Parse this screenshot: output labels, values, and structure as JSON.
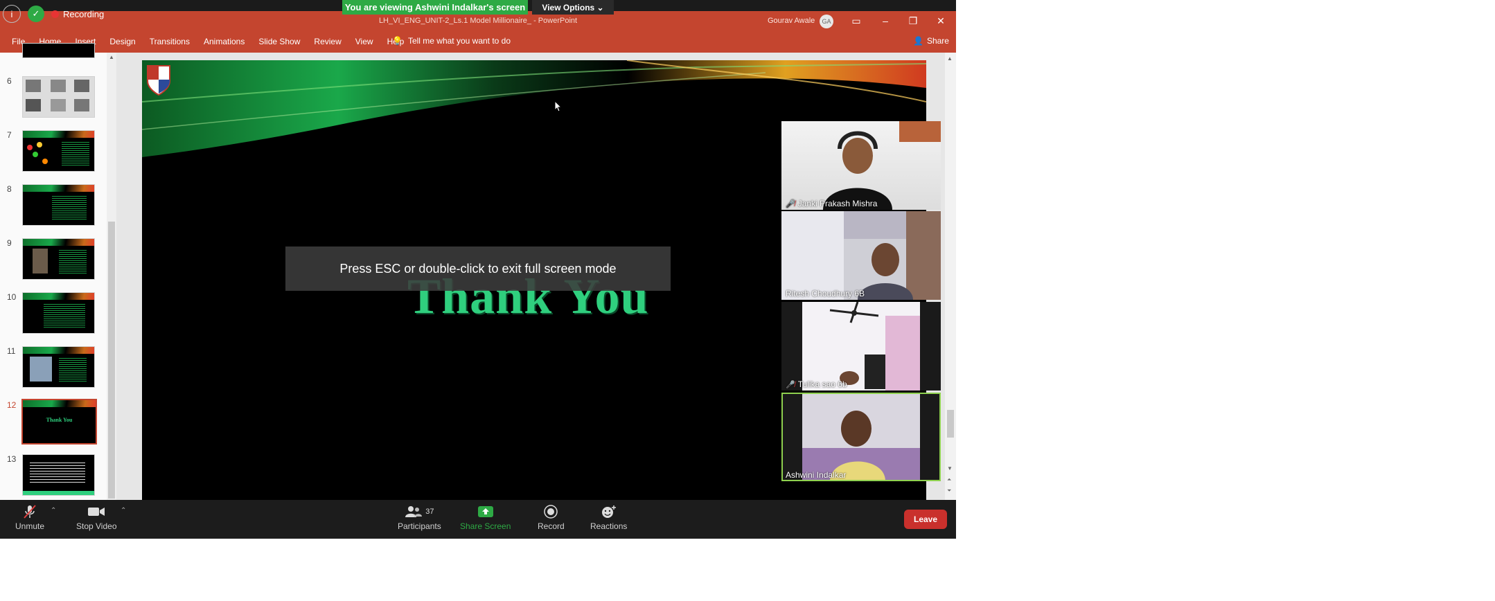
{
  "zoom": {
    "banner": "You are viewing Ashwini Indalkar's screen",
    "view_options": "View Options",
    "recording": "Recording"
  },
  "powerpoint": {
    "doc_title": "LH_VI_ENG_UNIT-2_Ls.1 Model Millionaire_ - PowerPoint",
    "user": "Gourav Awale",
    "user_initials": "GA",
    "ribbon_tabs": [
      "File",
      "Home",
      "Insert",
      "Design",
      "Transitions",
      "Animations",
      "Slide Show",
      "Review",
      "View",
      "Help"
    ],
    "tell_me": "Tell me what you want to do",
    "share": "Share",
    "slide_numbers": [
      "6",
      "7",
      "8",
      "9",
      "10",
      "11",
      "12",
      "13"
    ],
    "active_slide": "12",
    "active_slide_thumb_text": "Thank You",
    "slide_text": "Thank You"
  },
  "overlay": {
    "esc_message": "Press ESC or double-click to exit full screen mode"
  },
  "participants_video": [
    {
      "name": "Janki Prakash Mishra",
      "muted": true
    },
    {
      "name": "Ritesh Choudhury 6B",
      "muted": false
    },
    {
      "name": "Tulika sao 6b",
      "muted": true
    },
    {
      "name": "Ashwini Indalkar",
      "muted": false
    }
  ],
  "toolbar": {
    "unmute": "Unmute",
    "stop_video": "Stop Video",
    "participants": "Participants",
    "participants_count": "37",
    "share_screen": "Share Screen",
    "record": "Record",
    "reactions": "Reactions",
    "leave": "Leave"
  },
  "colors": {
    "ppt_accent": "#c4452f",
    "zoom_green": "#2eaa45",
    "leave_red": "#c9302c",
    "thank_you_green": "#2fcf7e"
  }
}
